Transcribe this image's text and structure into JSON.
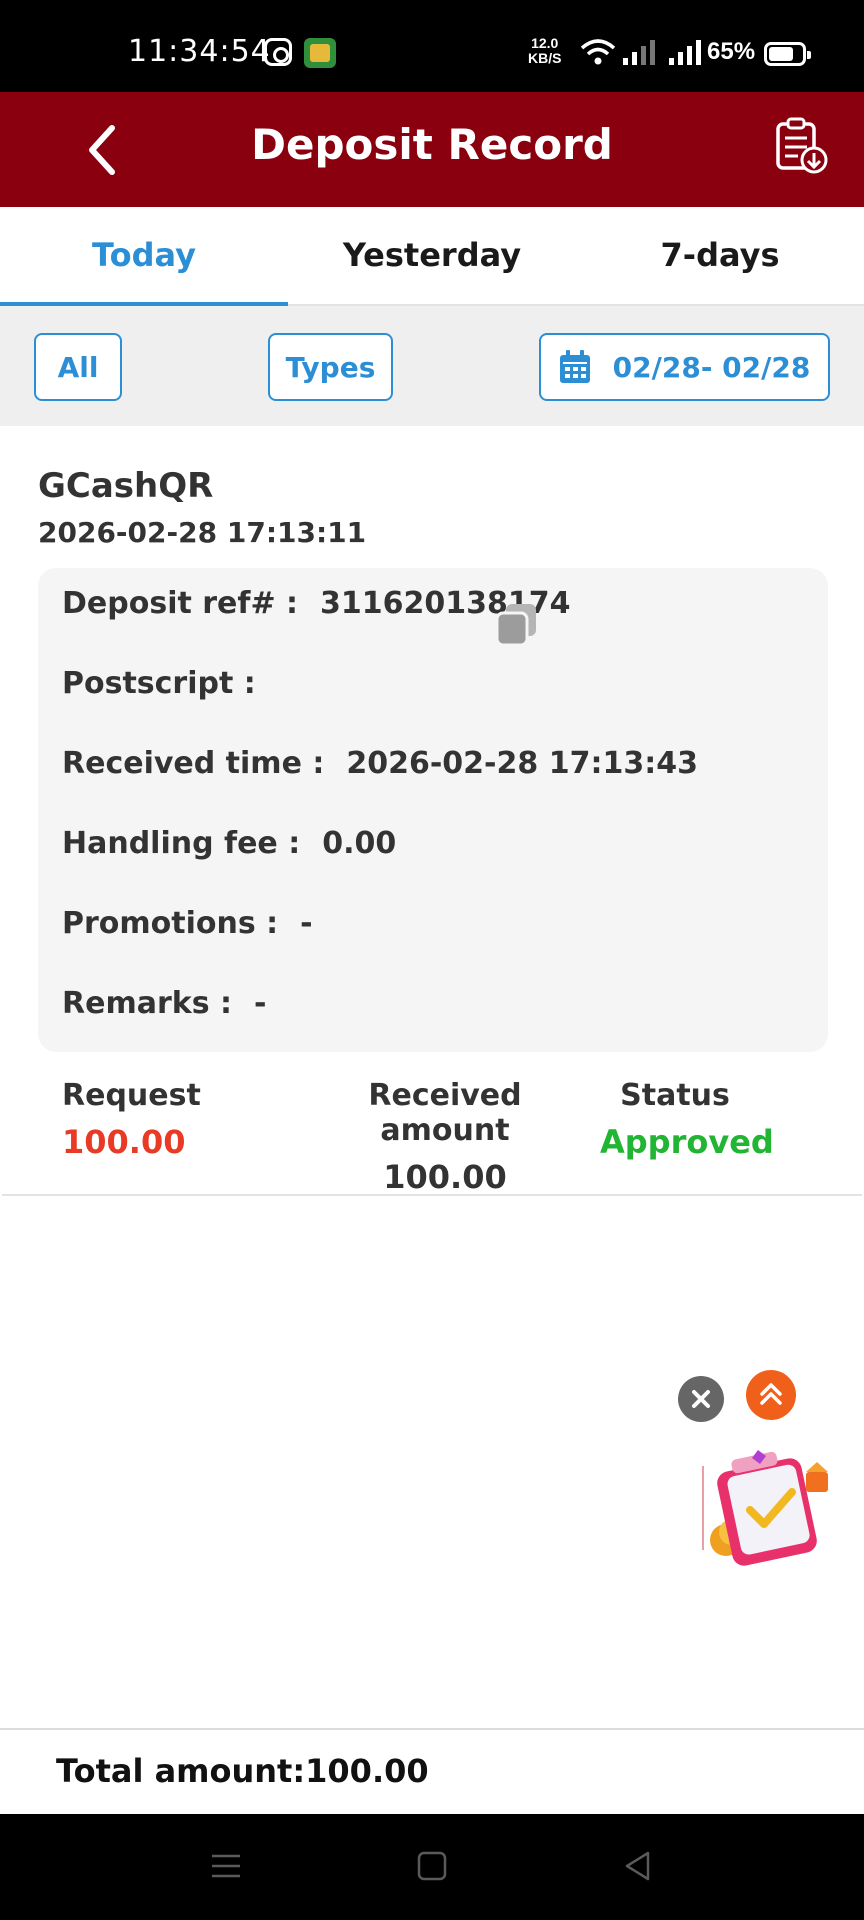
{
  "status_bar": {
    "time": "11:34:54",
    "net_speed_value": "12.0",
    "net_speed_unit": "KB/S",
    "battery": "65%"
  },
  "header": {
    "title": "Deposit Record",
    "back_icon": "chevron-left-icon",
    "export_icon": "clipboard-download-icon"
  },
  "tabs": [
    {
      "label": "Today",
      "active": true
    },
    {
      "label": "Yesterday",
      "active": false
    },
    {
      "label": "7-days",
      "active": false
    }
  ],
  "filters": {
    "all_label": "All",
    "types_label": "Types",
    "date_range": "02/28- 02/28",
    "accent_color": "#2c8fd6"
  },
  "record": {
    "method": "GCashQR",
    "created_at": "2026-02-28 17:13:11",
    "details": {
      "deposit_ref_label": "Deposit ref# :",
      "deposit_ref_value": "311620138174",
      "postscript_label": "Postscript :",
      "received_time_label": "Received time :",
      "received_time_value": "2026-02-28 17:13:43",
      "handling_fee_label": "Handling fee :",
      "handling_fee_value": "0.00",
      "promotions_label": "Promotions :",
      "promotions_value": "-",
      "remarks_label": "Remarks :",
      "remarks_value": "-"
    },
    "summary": {
      "request_label": "Request",
      "request_value": "100.00",
      "received_label": "Received amount",
      "received_value": "100.00",
      "status_label": "Status",
      "status_value": "Approved"
    },
    "colors": {
      "request": "#e83a24",
      "approved": "#21b533"
    }
  },
  "footer": {
    "total": "Total amount:100.00"
  },
  "theme": {
    "header_bg": "#8a000f"
  }
}
